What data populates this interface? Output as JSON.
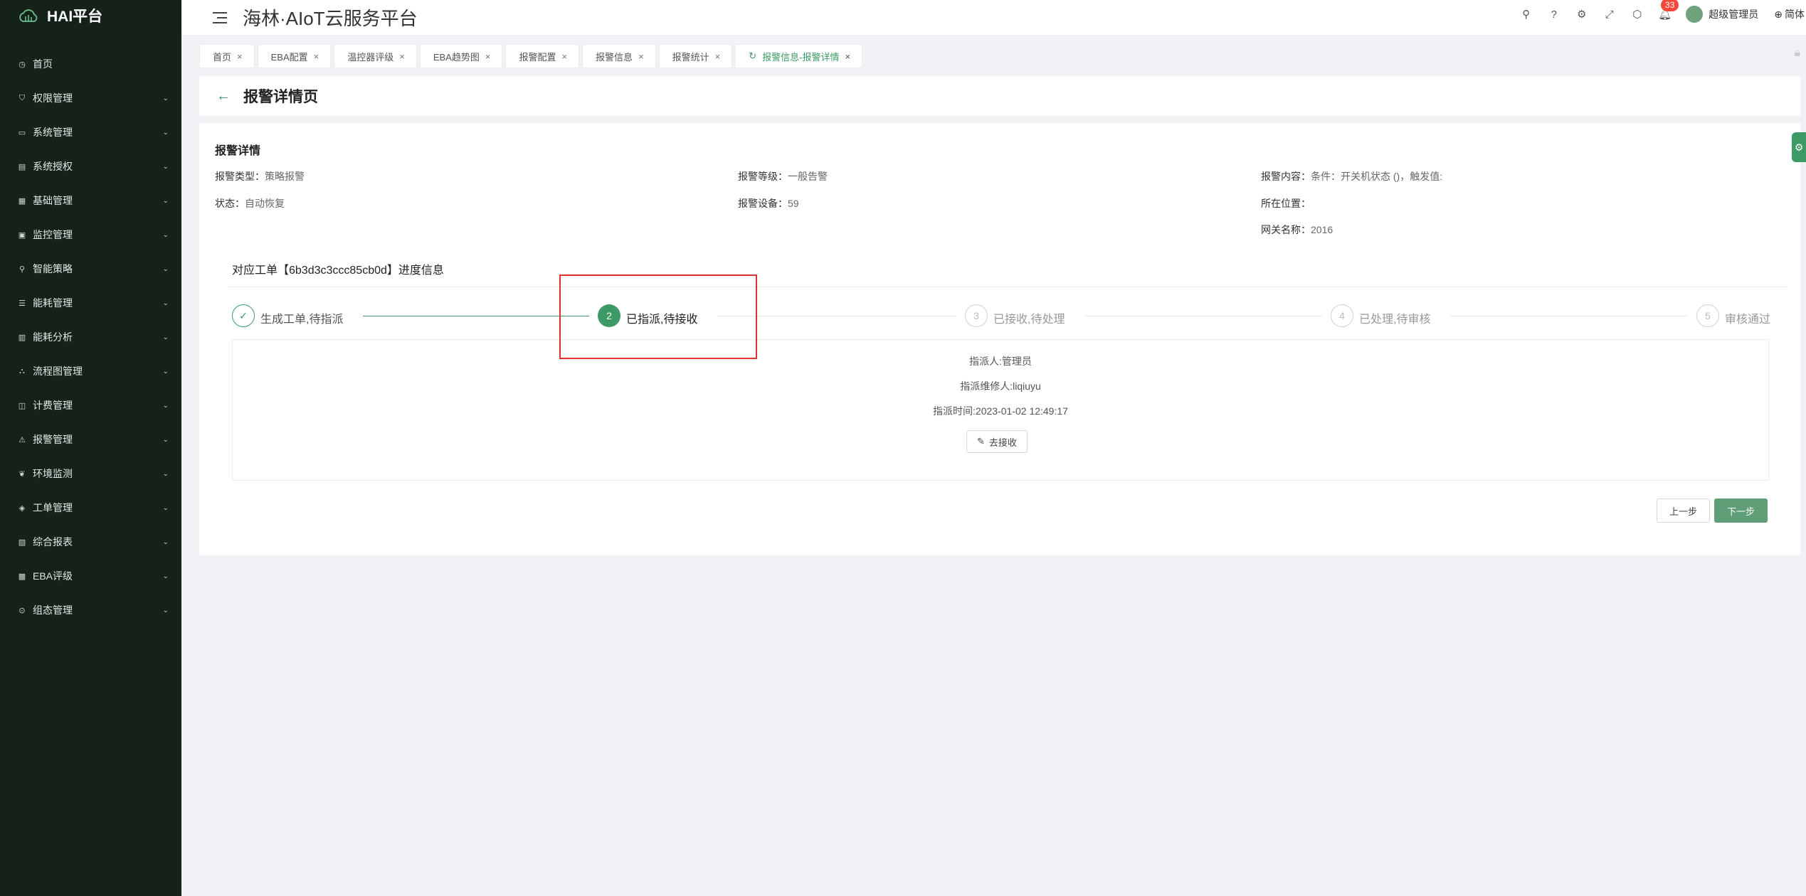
{
  "sidebar": {
    "logo_text": "HAI平台",
    "items": [
      {
        "label": "首页",
        "icon": "dashboard-icon",
        "glyph": "◷",
        "has_children": false
      },
      {
        "label": "权限管理",
        "icon": "shield-icon",
        "glyph": "⛉",
        "has_children": true
      },
      {
        "label": "系统管理",
        "icon": "monitor-icon",
        "glyph": "▭",
        "has_children": true
      },
      {
        "label": "系统授权",
        "icon": "document-icon",
        "glyph": "▤",
        "has_children": true
      },
      {
        "label": "基础管理",
        "icon": "table-icon",
        "glyph": "▦",
        "has_children": true
      },
      {
        "label": "监控管理",
        "icon": "screen-icon",
        "glyph": "▣",
        "has_children": true
      },
      {
        "label": "智能策略",
        "icon": "location-icon",
        "glyph": "⚲",
        "has_children": true
      },
      {
        "label": "能耗管理",
        "icon": "sliders-icon",
        "glyph": "☰",
        "has_children": true
      },
      {
        "label": "能耗分析",
        "icon": "chart-icon",
        "glyph": "▥",
        "has_children": true
      },
      {
        "label": "流程图管理",
        "icon": "flow-icon",
        "glyph": "⛬",
        "has_children": true
      },
      {
        "label": "计费管理",
        "icon": "wallet-icon",
        "glyph": "◫",
        "has_children": true
      },
      {
        "label": "报警管理",
        "icon": "alarm-icon",
        "glyph": "⚠",
        "has_children": true
      },
      {
        "label": "环境监测",
        "icon": "leaf-icon",
        "glyph": "❦",
        "has_children": true
      },
      {
        "label": "工单管理",
        "icon": "layers-icon",
        "glyph": "◈",
        "has_children": true
      },
      {
        "label": "综合报表",
        "icon": "report-icon",
        "glyph": "▨",
        "has_children": true
      },
      {
        "label": "EBA评级",
        "icon": "grade-icon",
        "glyph": "▩",
        "has_children": true
      },
      {
        "label": "组态管理",
        "icon": "config-icon",
        "glyph": "⊙",
        "has_children": true
      }
    ]
  },
  "header": {
    "title": "海林·AIoT云服务平台",
    "notification_count": "33",
    "user_name": "超级管理员",
    "language": "简体"
  },
  "tabs": [
    {
      "label": "首页",
      "active": false
    },
    {
      "label": "EBA配置",
      "active": false
    },
    {
      "label": "温控器评级",
      "active": false
    },
    {
      "label": "EBA趋势图",
      "active": false
    },
    {
      "label": "报警配置",
      "active": false
    },
    {
      "label": "报警信息",
      "active": false
    },
    {
      "label": "报警统计",
      "active": false
    },
    {
      "label": "报警信息-报警详情",
      "active": true
    }
  ],
  "page": {
    "title": "报警详情页"
  },
  "alarm_detail": {
    "section_title": "报警详情",
    "alarm_type_label": "报警类型：",
    "alarm_type_value": "策略报警",
    "alarm_level_label": "报警等级：",
    "alarm_level_value": "一般告警",
    "alarm_content_label": "报警内容：",
    "alarm_content_value": "条件：开关机状态 ()，触发值:",
    "status_label": "状态：",
    "status_value": "自动恢复",
    "device_label": "报警设备：",
    "device_value": "59",
    "location_label": "所在位置：",
    "location_value": "",
    "gateway_label": "网关名称：",
    "gateway_value": "2016"
  },
  "work_order": {
    "title": "对应工单【6b3d3c3ccc85cb0d】进度信息",
    "steps": [
      {
        "number": "1",
        "label": "生成工单,待指派",
        "state": "done"
      },
      {
        "number": "2",
        "label": "已指派,待接收",
        "state": "active"
      },
      {
        "number": "3",
        "label": "已接收,待处理",
        "state": "wait"
      },
      {
        "number": "4",
        "label": "已处理,待审核",
        "state": "wait"
      },
      {
        "number": "5",
        "label": "审核通过",
        "state": "wait"
      }
    ],
    "assigner": "指派人:管理员",
    "repairer": "指派维修人:liqiuyu",
    "assign_time": "指派时间:2023-01-02 12:49:17",
    "accept_button": "去接收",
    "prev_button": "上一步",
    "next_button": "下一步"
  },
  "colors": {
    "accent": "#3d9a66",
    "sidebar_bg": "#15221a",
    "highlight": "#e02f2f"
  }
}
